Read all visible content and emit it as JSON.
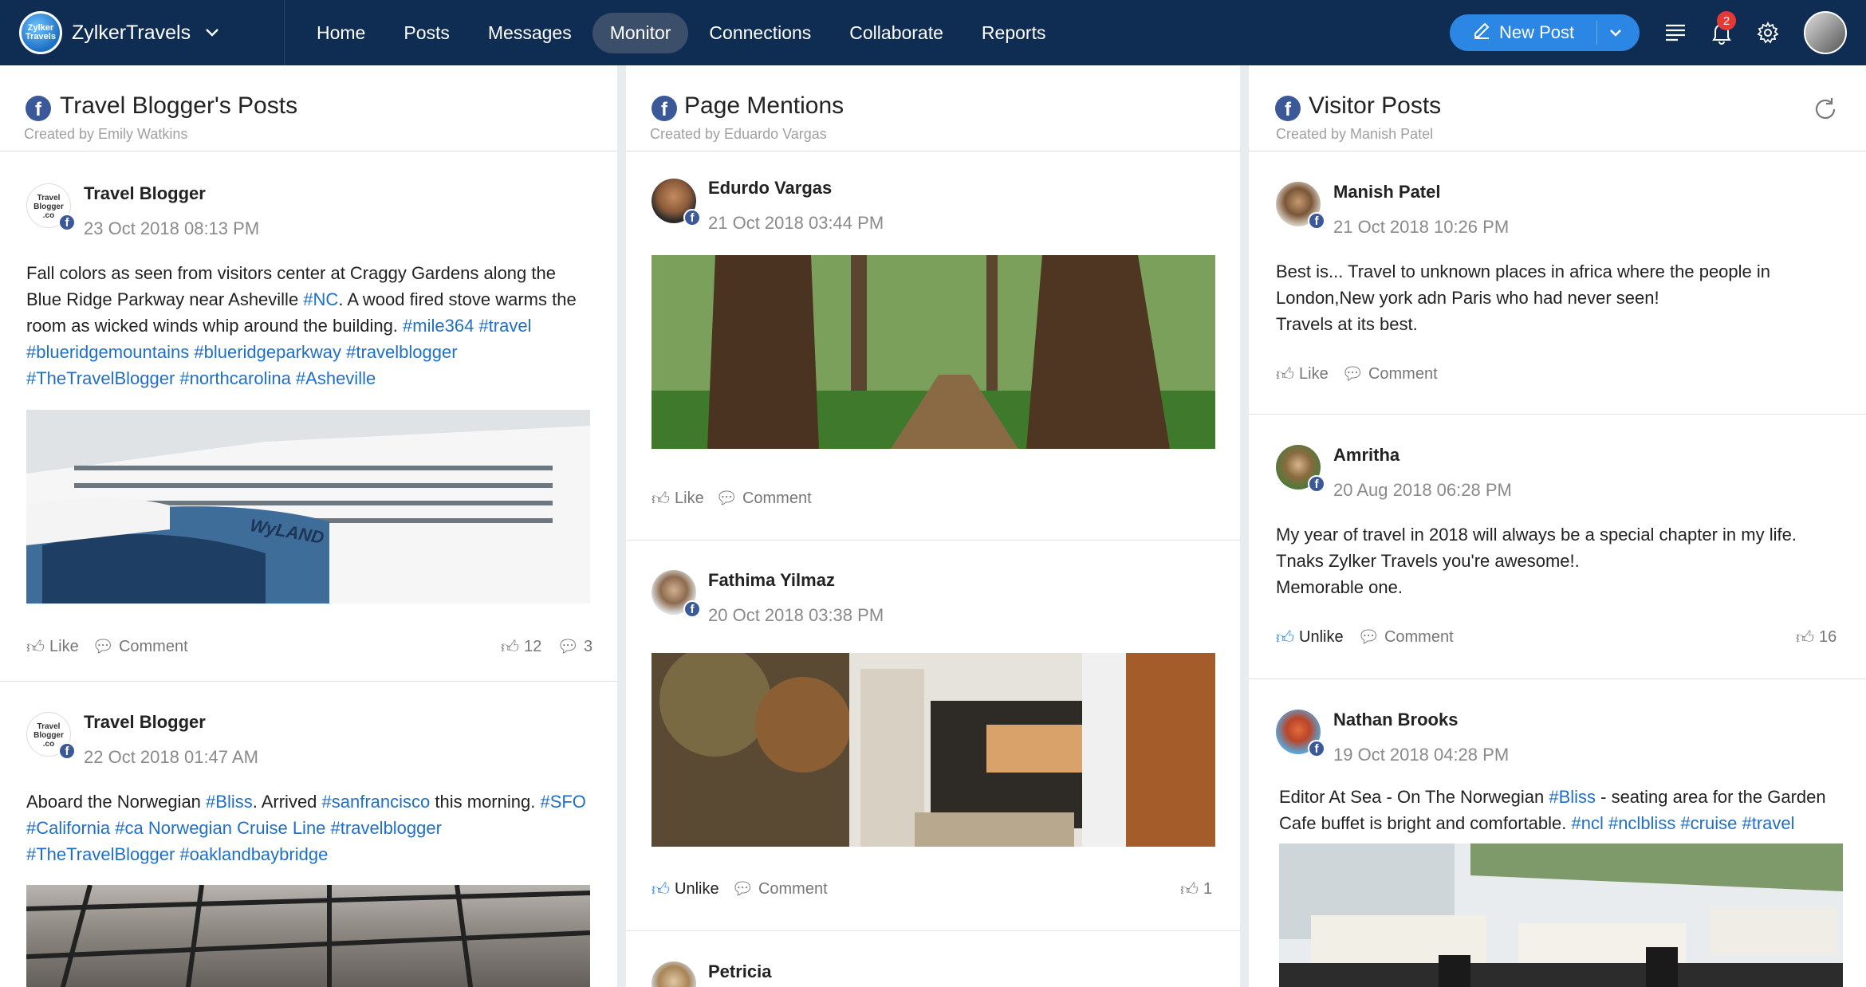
{
  "brand": {
    "name": "ZylkerTravels",
    "logo_text": "Zylker Travels"
  },
  "nav": [
    "Home",
    "Posts",
    "Messages",
    "Monitor",
    "Connections",
    "Collaborate",
    "Reports"
  ],
  "nav_active": "Monitor",
  "toolbar": {
    "new_post": "New Post",
    "notification_count": "2"
  },
  "icons": [
    "pen-icon",
    "chevron-down-icon",
    "list-icon",
    "bell-icon",
    "gear-icon",
    "facebook-icon",
    "refresh-icon",
    "thumbs-up-icon",
    "comment-icon"
  ],
  "colors": {
    "topbar": "#0f2d52",
    "accent": "#2c86e3",
    "hashtag": "#1f6fc5",
    "facebook": "#3b5998"
  },
  "columns": [
    {
      "title": "Travel Blogger's Posts",
      "creator": "Created by Emily Watkins",
      "posts": [
        {
          "author": "Travel Blogger",
          "avatar_text": "Travel Blogger .co",
          "date": "23 Oct 2018 08:13 PM",
          "text_parts": [
            "Fall colors as seen from visitors center at Craggy Gardens along the Blue Ridge Parkway near Asheville ",
            "#NC",
            ". A wood fired stove warms the room as wicked winds whip around the building. ",
            "#mile364 #travel #blueridgemountains #blueridgeparkway #travelblogger #TheTravelBlogger #northcarolina #Asheville"
          ],
          "image_caption": "WyLAND",
          "like": "Like",
          "comment": "Comment",
          "likes_count": "12",
          "comments_count": "3"
        },
        {
          "author": "Travel Blogger",
          "avatar_text": "Travel Blogger .co",
          "date": "22 Oct 2018 01:47 AM",
          "text_parts": [
            "Aboard the Norwegian ",
            "#Bliss",
            ". Arrived ",
            "#sanfrancisco",
            " this morning. ",
            "#SFO #California #ca Norwegian Cruise Line #travelblogger #TheTravelBlogger #oaklandbaybridge"
          ]
        }
      ]
    },
    {
      "title": "Page Mentions",
      "creator": "Created by Eduardo Vargas",
      "posts": [
        {
          "author": "Edurdo Vargas",
          "date": "21 Oct 2018 03:44 PM",
          "like": "Like",
          "comment": "Comment"
        },
        {
          "author": "Fathima Yilmaz",
          "date": "20 Oct 2018 03:38 PM",
          "like": "Unlike",
          "comment": "Comment",
          "likes_count": "1"
        },
        {
          "author": "Petricia"
        }
      ]
    },
    {
      "title": "Visitor Posts",
      "creator": "Created by Manish Patel",
      "posts": [
        {
          "author": "Manish Patel",
          "date": "21 Oct 2018 10:26 PM",
          "text": "Best is... Travel to unknown places in africa where the people in London,New york adn Paris who had never seen!\nTravels at its best.",
          "like": "Like",
          "comment": "Comment"
        },
        {
          "author": "Amritha",
          "date": "20 Aug 2018 06:28 PM",
          "text": "My year of travel in 2018 will always be a special chapter in my life.\nTnaks Zylker Travels you're awesome!.\nMemorable one.",
          "like": "Unlike",
          "comment": "Comment",
          "likes_count": "16"
        },
        {
          "author": "Nathan Brooks",
          "date": "19 Oct 2018 04:28 PM",
          "text_parts": [
            "Editor At Sea - On The Norwegian ",
            "#Bliss",
            " - seating area for the Garden Cafe buffet is bright and comfortable. ",
            "#ncl #nclbliss #cruise #travel"
          ]
        }
      ]
    }
  ]
}
